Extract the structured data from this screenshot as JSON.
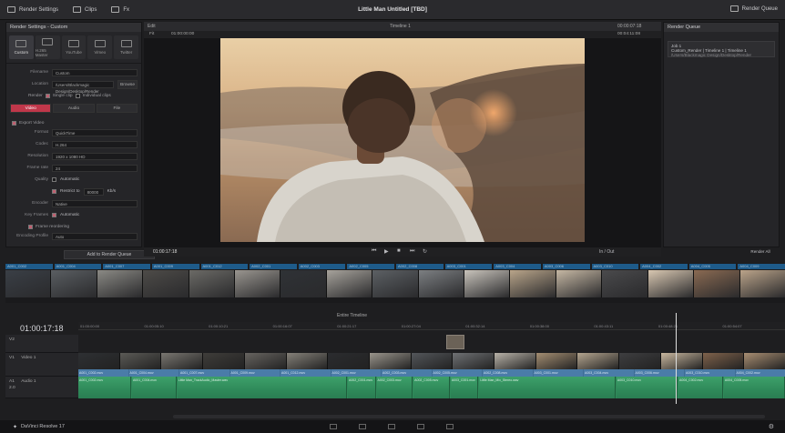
{
  "topbar": {
    "render_settings": "Render Settings",
    "clips": "Clips",
    "fx": "Fx",
    "project_title": "Little Man Untitled [TBD]",
    "render_queue": "Render Queue"
  },
  "render_settings": {
    "header": "Render Settings - Custom",
    "presets": [
      "Custom",
      "H.265 Master",
      "YouTube",
      "Vimeo",
      "Twitter"
    ],
    "filename_label": "Filename",
    "filename_value": "Custom",
    "location_label": "Location",
    "location_value": "/Users/Blackmagic Design/Desktop/Render",
    "browse_label": "Browse",
    "render_label": "Render",
    "single_clip": "Single clip",
    "individual_clips": "Individual clips",
    "tabs": [
      "Video",
      "Audio",
      "File"
    ],
    "export_video": "Export Video",
    "format_label": "Format",
    "format_value": "QuickTime",
    "codec_label": "Codec",
    "codec_value": "H.264",
    "resolution_label": "Resolution",
    "resolution_value": "1920 x 1080 HD",
    "framerate_label": "Frame rate",
    "framerate_value": "24",
    "quality_label": "Quality",
    "automatic": "Automatic",
    "restrict": "Restrict to",
    "kbps": "80000",
    "kbps_unit": "Kb/s",
    "encoder_label": "Encoder",
    "encoder_value": "Native",
    "key_frames_label": "Key Frames",
    "key_frames_value": "Automatic",
    "frame_reordering": "Frame reordering",
    "encoding_profile_label": "Encoding Profile",
    "encoding_profile_value": "Auto",
    "add_to_queue": "Add to Render Queue"
  },
  "viewer": {
    "tab_label": "Edit",
    "timeline_name": "Timeline 1",
    "source_tc": "01:00:00:00",
    "duration_tc": "00:04:11:08",
    "zoom": "Fit",
    "tc_right": "00:00:07:18",
    "current_tc": "01:00:17:18",
    "in_out": "In / Out"
  },
  "queue": {
    "header": "Render Queue",
    "job_title": "Job 1",
    "job_line1": "Custom_Render | Timeline 1 | Timeline 1",
    "job_line2": "/Users/Blackmagic Design/Desktop/Render",
    "render_all": "Render All"
  },
  "clips": {
    "tags": [
      "A001_C002",
      "A001_C004",
      "A001_C007",
      "A001_C009",
      "A001_C012",
      "A002_C001",
      "A002_C003",
      "A002_C005",
      "A002_C008",
      "A003_C001",
      "A003_C004",
      "A003_C006",
      "A003_C010",
      "A004_C002",
      "A004_C005",
      "A004_C009"
    ],
    "thumb_colors": [
      "#3a3f46",
      "#5a5e62",
      "#8b8a85",
      "#4d4b48",
      "#6b6a66",
      "#9a9690",
      "#2f3236",
      "#a7a39c",
      "#5c6064",
      "#7c7f82",
      "#c9c4bc",
      "#b9a58a",
      "#c6b8a4",
      "#4a4a4c",
      "#d9c8b2",
      "#8a6a52",
      "#bba48a"
    ]
  },
  "timeline": {
    "current_tc": "01:00:17:18",
    "render_range": "Entire Timeline",
    "ruler": [
      "01:00:00:00",
      "01:00:05:10",
      "01:00:10:21",
      "01:00:16:07",
      "01:00:21:17",
      "01:00:27:04",
      "01:00:32:14",
      "01:00:38:00",
      "01:00:43:11",
      "01:00:48:21",
      "01:00:54:07"
    ],
    "tracks": {
      "v2": "V2",
      "v1_name": "V1",
      "v1_label": "Video 1",
      "a1_name": "A1",
      "a1_label": "Audio 1",
      "a1_level": "2.0"
    },
    "video_clip_colors": [
      "#2e3033",
      "#5b5a56",
      "#7a7771",
      "#3f3d3a",
      "#676460",
      "#858179",
      "#2b2c2f",
      "#9a958c",
      "#53565a",
      "#6f7174",
      "#b8b2a8",
      "#a48e72",
      "#b4a58f",
      "#3e3e40",
      "#c8b79f",
      "#7f624b",
      "#a88e72"
    ],
    "video_labels": [
      "A001_C002.mov",
      "A001_C004.mov",
      "A001_C007.mov",
      "A001_C009.mov",
      "A001_C012.mov",
      "A002_C001.mov",
      "A002_C003.mov",
      "A002_C005.mov",
      "A002_C008.mov",
      "A003_C001.mov",
      "A003_C004.mov",
      "A003_C006.mov",
      "A003_C010.mov",
      "A004_C002.mov"
    ],
    "audio_clips": [
      "A001_C002.mov",
      "A001_C004.mov",
      "Little Man_TrackAudio_Master.wav",
      "A002_C001.mov",
      "A002_C003.mov",
      "A002_C005.mov",
      "A003_C001.mov",
      "Little Man_Mix_Stereo.wav",
      "A003_C010.mov",
      "A004_C002.mov",
      "A004_C005.mov"
    ],
    "audio_clip_widths": [
      6,
      5,
      20,
      3,
      4,
      4,
      3,
      16,
      7,
      5,
      7
    ]
  },
  "bottom": {
    "app_name": "DaVinci Resolve 17"
  }
}
